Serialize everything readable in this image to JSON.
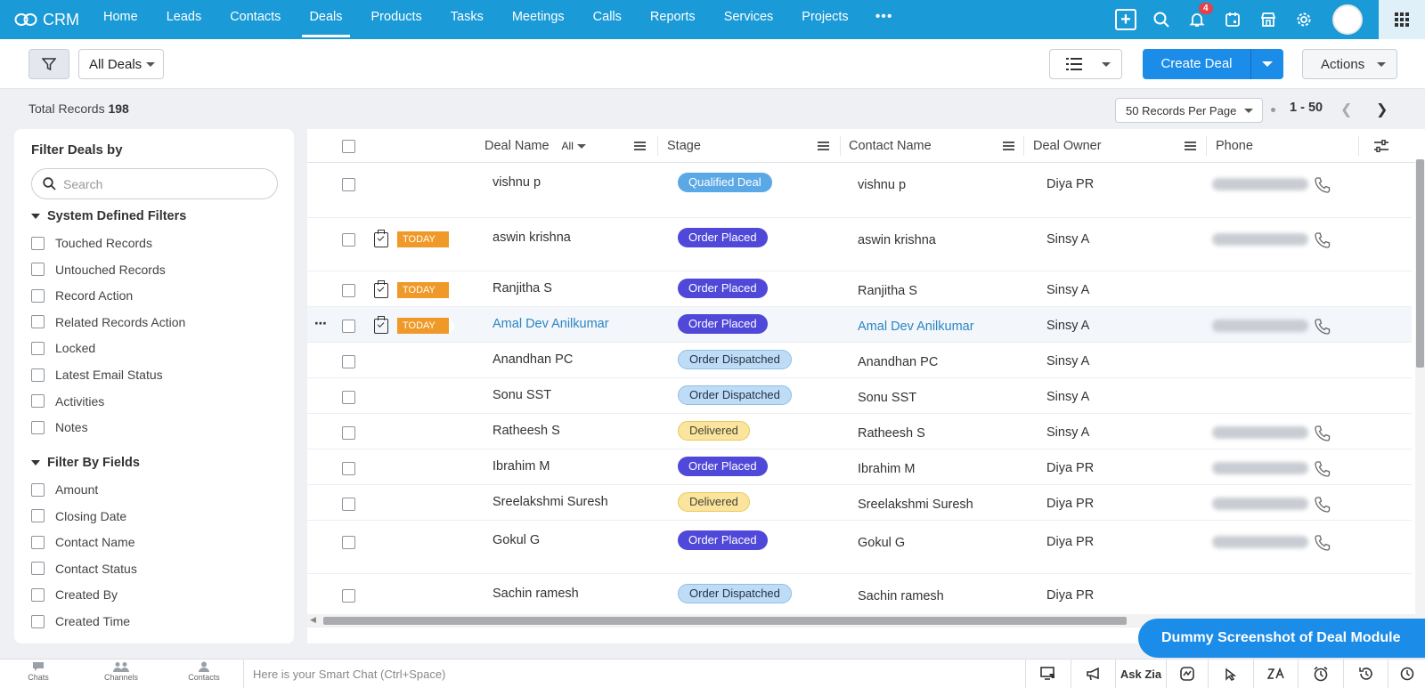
{
  "nav": {
    "brand": "CRM",
    "tabs": [
      "Home",
      "Leads",
      "Contacts",
      "Deals",
      "Products",
      "Tasks",
      "Meetings",
      "Calls",
      "Reports",
      "Services",
      "Projects"
    ],
    "active": "Deals",
    "more": "•••",
    "notification_count": "4"
  },
  "toolbar": {
    "view_name": "All Deals",
    "create_label": "Create Deal",
    "actions_label": "Actions"
  },
  "records": {
    "total_label": "Total Records",
    "total_count": "198",
    "per_page": "50 Records Per Page",
    "range": "1 - 50"
  },
  "sidebar": {
    "title": "Filter Deals by",
    "search_placeholder": "Search",
    "system_section": "System Defined Filters",
    "system_filters": [
      "Touched Records",
      "Untouched Records",
      "Record Action",
      "Related Records Action",
      "Locked",
      "Latest Email Status",
      "Activities",
      "Notes"
    ],
    "fields_section": "Filter By Fields",
    "field_filters": [
      "Amount",
      "Closing Date",
      "Contact Name",
      "Contact Status",
      "Created By",
      "Created Time"
    ]
  },
  "table": {
    "columns": {
      "deal_name": "Deal Name",
      "all_filter": "All",
      "stage": "Stage",
      "contact_name": "Contact Name",
      "deal_owner": "Deal Owner",
      "phone": "Phone"
    },
    "today_label": "TODAY",
    "rows": [
      {
        "deal": "vishnu p",
        "stage": "Qualified Deal",
        "contact": "vishnu p",
        "owner": "Diya PR"
      },
      {
        "deal": "aswin krishna",
        "stage": "Order Placed",
        "contact": "aswin krishna",
        "owner": "Sinsy A"
      },
      {
        "deal": "Ranjitha S",
        "stage": "Order Placed",
        "contact": "Ranjitha S",
        "owner": "Sinsy A"
      },
      {
        "deal": "Amal Dev Anilkumar",
        "stage": "Order Placed",
        "contact": "Amal Dev Anilkumar",
        "owner": "Sinsy A"
      },
      {
        "deal": "Anandhan PC",
        "stage": "Order Dispatched",
        "contact": "Anandhan PC",
        "owner": "Sinsy A"
      },
      {
        "deal": "Sonu SST",
        "stage": "Order Dispatched",
        "contact": "Sonu SST",
        "owner": "Sinsy A"
      },
      {
        "deal": "Ratheesh S",
        "stage": "Delivered",
        "contact": "Ratheesh S",
        "owner": "Sinsy A"
      },
      {
        "deal": "Ibrahim M",
        "stage": "Order Placed",
        "contact": "Ibrahim M",
        "owner": "Diya PR"
      },
      {
        "deal": "Sreelakshmi Suresh",
        "stage": "Delivered",
        "contact": "Sreelakshmi Suresh",
        "owner": "Diya PR"
      },
      {
        "deal": "Gokul G",
        "stage": "Order Placed",
        "contact": "Gokul G",
        "owner": "Diya PR"
      },
      {
        "deal": "Sachin ramesh",
        "stage": "Order Dispatched",
        "contact": "Sachin ramesh",
        "owner": "Diya PR"
      }
    ]
  },
  "banner": "Dummy Screenshot of  Deal Module",
  "bottom": {
    "chats": "Chats",
    "channels": "Channels",
    "contacts": "Contacts",
    "smart_chat": "Here is your Smart Chat (Ctrl+Space)",
    "ask_zia": "Ask Zia"
  },
  "colors": {
    "nav_bg": "#1a9ad6",
    "primary": "#1b8ce8",
    "order_placed": "#4f48d8",
    "qualified": "#5aa8e6",
    "dispatched": "#bfdcf7",
    "delivered": "#fbe59e",
    "today": "#ef9a28"
  }
}
